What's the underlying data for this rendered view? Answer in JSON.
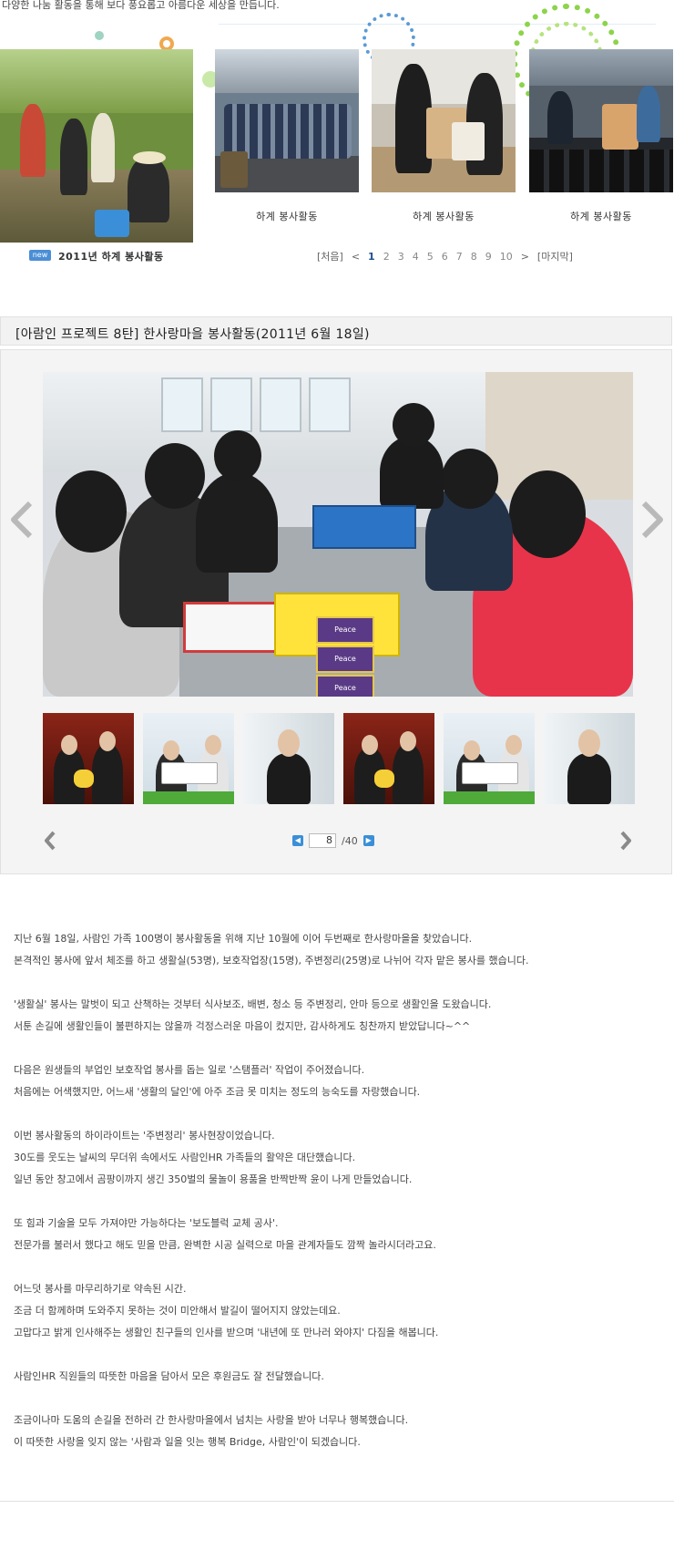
{
  "intro": "다양한 나눔 활동을 통해 보다 풍요롭고 아름다운 세상을 만듭니다.",
  "gallery_list": {
    "featured": {
      "badge": "new",
      "caption": "2011년 하계 봉사활동"
    },
    "thumbnails": [
      {
        "caption": "하계 봉사활동"
      },
      {
        "caption": "하계 봉사활동"
      },
      {
        "caption": "하계 봉사활동"
      }
    ],
    "pagination": {
      "first": "[처음]",
      "prev": "<",
      "pages": [
        "1",
        "2",
        "3",
        "4",
        "5",
        "6",
        "7",
        "8",
        "9",
        "10"
      ],
      "current": "1",
      "next": ">",
      "last": "[마지막]"
    }
  },
  "article": {
    "title": "[아람인 프로젝트 8탄] 한사랑마을 봉사활동(2011년 6월 18일)",
    "viewer": {
      "image_text": {
        "brand": "Peace"
      },
      "current_page": "8",
      "total_pages": "/40"
    },
    "paragraphs": [
      [
        "지난 6월 18일, 사람인 가족 100명이 봉사활동을 위해 지난 10월에 이어 두번째로 한사랑마을을 찾았습니다.",
        "본격적인 봉사에 앞서 체조를 하고 생활실(53명), 보호작업장(15명), 주변정리(25명)로 나뉘어 각자 맡은 봉사를 했습니다."
      ],
      [
        "'생활실' 봉사는 말벗이 되고 산책하는 것부터 식사보조, 배변, 청소 등 주변정리, 안마 등으로 생활인을 도왔습니다.",
        "서툰 손길에 생활인들이 불편하지는 않을까 걱정스러운 마음이 컸지만, 감사하게도 칭찬까지 받았답니다~^^"
      ],
      [
        "다음은 원생들의 부업인 보호작업 봉사를 돕는 일로 '스탬플러' 작업이 주어졌습니다.",
        "처음에는 어색했지만, 어느새 '생활의 달인'에 아주 조금 못 미치는 정도의 능숙도를 자랑했습니다."
      ],
      [
        "이번 봉사활동의 하이라이트는 '주변정리' 봉사현장이었습니다.",
        "30도를 웃도는 날씨의 무더위 속에서도 사람인HR 가족들의 활약은 대단했습니다.",
        "일년 동안 창고에서 곰팡이까지 생긴 350벌의 물놀이 용품을 반짝반짝 윤이 나게 만들었습니다."
      ],
      [
        "또 힘과 기술을 모두 가져야만 가능하다는 '보도블럭 교체 공사'.",
        "전문가를 불러서 했다고 해도 믿을 만큼, 완벽한 시공 실력으로 마을 관계자들도 깜짝 놀라시더라고요."
      ],
      [
        "어느덧 봉사를 마무리하기로 약속된 시간.",
        "조금 더 함께하며 도와주지 못하는 것이 미안해서 발길이 떨어지지 않았는데요.",
        "고맙다고 밝게 인사해주는 생활인 친구들의 인사를 받으며 '내년에 또 만나러 와야지' 다짐을 해봅니다."
      ],
      [
        "사람인HR 직원들의 따뜻한 마음을 담아서 모은 후원금도 잘 전달했습니다."
      ],
      [
        "조금이나마 도움의 손길을 전하러 간 한사랑마을에서 넘치는 사랑을 받아 너무나 행복했습니다.",
        "이 따뜻한 사랑을 잊지 않는 '사람과 일을 잇는 행복 Bridge, 사람인'이 되겠습니다."
      ]
    ]
  },
  "colors": {
    "accent_blue": "#4a8ed6",
    "pager_current": "#1f4f8f",
    "title_bar": "#f2f2f2"
  },
  "icons": [
    "prev-arrow-icon",
    "next-arrow-icon",
    "small-prev-arrow-icon",
    "small-next-arrow-icon",
    "prev-page-button-icon",
    "next-page-button-icon"
  ]
}
